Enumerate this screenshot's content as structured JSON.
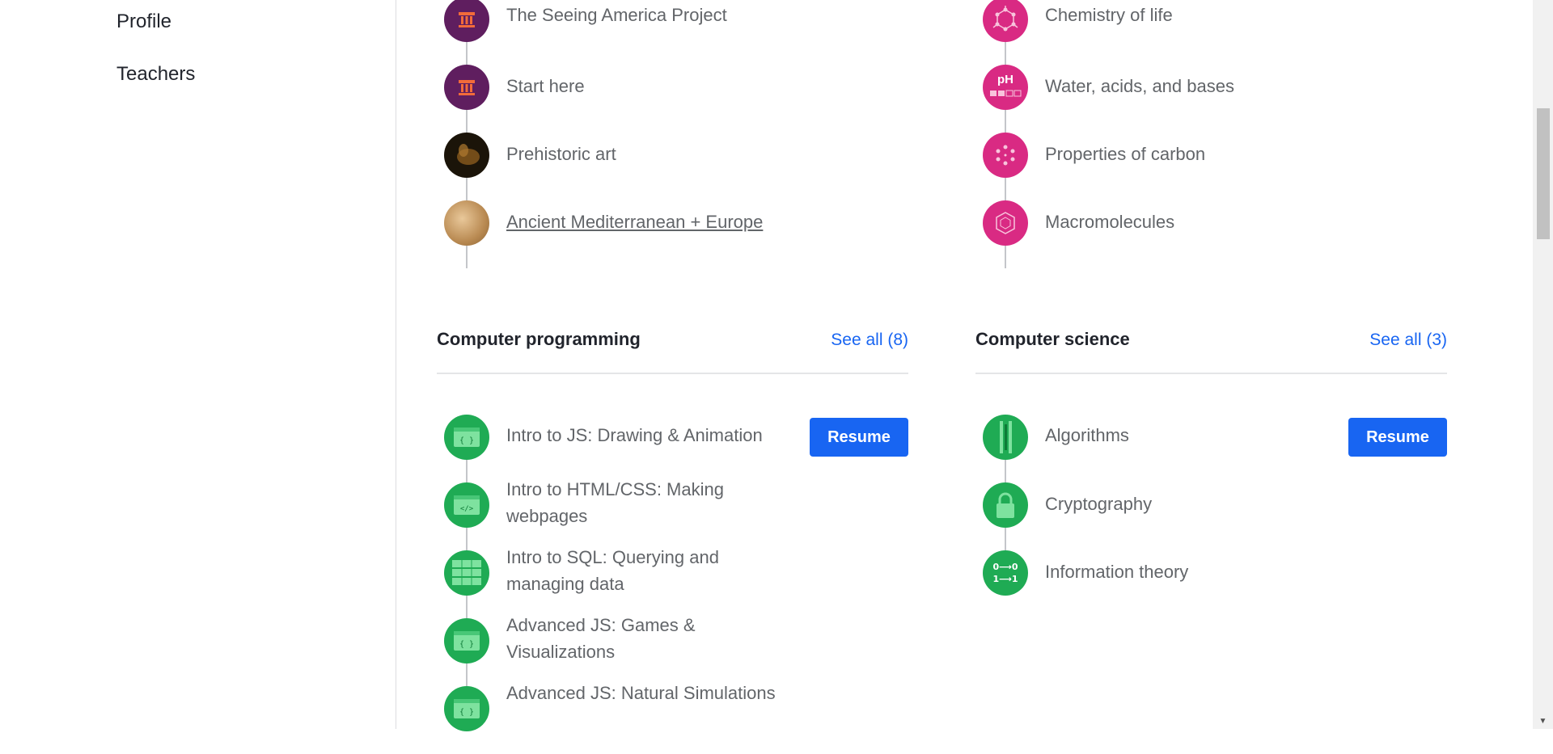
{
  "sidebar": {
    "items": [
      {
        "label": "Profile"
      },
      {
        "label": "Teachers"
      }
    ]
  },
  "arts": {
    "items": [
      {
        "label": "The Seeing America Project",
        "icon": "column-icon"
      },
      {
        "label": "Start here",
        "icon": "column-icon"
      },
      {
        "label": "Prehistoric art",
        "icon": "cave-art-icon"
      },
      {
        "label": "Ancient Mediterranean + Europe",
        "icon": "fresco-icon"
      }
    ]
  },
  "biology": {
    "items": [
      {
        "label": "Chemistry of life",
        "icon": "molecule-icon"
      },
      {
        "label": "Water, acids, and bases",
        "icon": "ph-icon",
        "icon_text": "pH"
      },
      {
        "label": "Properties of carbon",
        "icon": "carbon-ring-icon"
      },
      {
        "label": "Macromolecules",
        "icon": "hexagon-icon"
      }
    ]
  },
  "programming": {
    "title": "Computer programming",
    "see_all": "See all (8)",
    "resume": "Resume",
    "items": [
      {
        "label": "Intro to JS: Drawing & Animation",
        "icon": "code-window-icon",
        "icon_text": "{ }"
      },
      {
        "label": "Intro to HTML/CSS: Making webpages",
        "icon": "code-window-icon",
        "icon_text": "</>"
      },
      {
        "label": "Intro to SQL: Querying and managing data",
        "icon": "table-icon"
      },
      {
        "label": "Advanced JS: Games & Visualizations",
        "icon": "code-window-icon",
        "icon_text": "{ }"
      },
      {
        "label": "Advanced JS: Natural Simulations",
        "icon": "code-window-icon",
        "icon_text": "{ }"
      }
    ]
  },
  "cs": {
    "title": "Computer science",
    "see_all": "See all (3)",
    "resume": "Resume",
    "items": [
      {
        "label": "Algorithms",
        "icon": "circuit-icon"
      },
      {
        "label": "Cryptography",
        "icon": "lock-icon"
      },
      {
        "label": "Information theory",
        "icon": "binary-icon",
        "icon_text_top": "0⟶0",
        "icon_text_bottom": "1⟶1"
      }
    ]
  },
  "colors": {
    "accent": "#1865f2",
    "purple": "#5f1e5f",
    "pink": "#d92a83",
    "green": "#1fab54"
  }
}
